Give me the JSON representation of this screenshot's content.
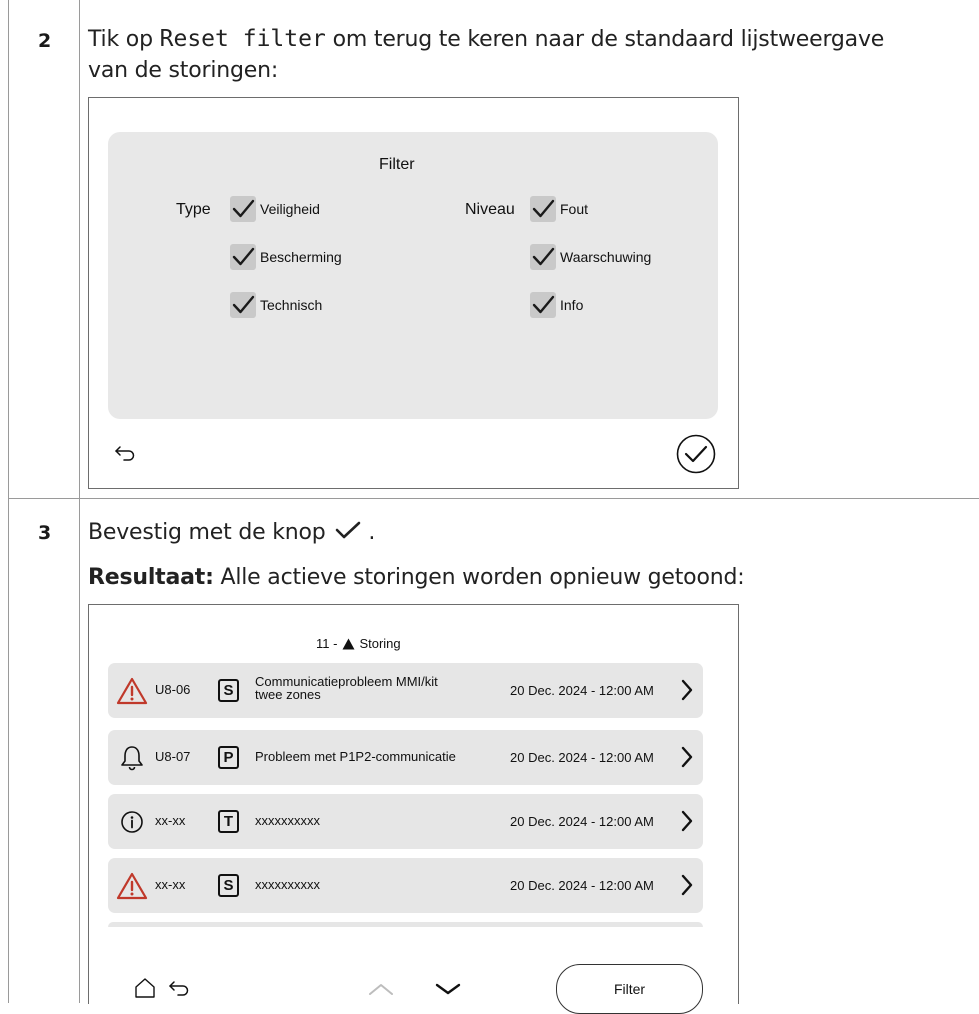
{
  "steps": [
    {
      "number": "2",
      "text_before": "Tik op ",
      "code": "Reset filter",
      "text_after": " om terug te keren naar de standaard lijstweergave",
      "text_line2": "van de storingen:"
    },
    {
      "number": "3",
      "text_before": "Bevestig met de knop ",
      "text_after": ".",
      "result_label": "Resultaat:",
      "result_text": " Alle actieve storingen worden opnieuw getoond:"
    }
  ],
  "filter_screen": {
    "title": "Filter",
    "type_group": {
      "label": "Type",
      "options": [
        {
          "label": "Veiligheid",
          "checked": true
        },
        {
          "label": "Bescherming",
          "checked": true
        },
        {
          "label": "Technisch",
          "checked": true
        }
      ]
    },
    "level_group": {
      "label": "Niveau",
      "options": [
        {
          "label": "Fout",
          "checked": true
        },
        {
          "label": "Waarschuwing",
          "checked": true
        },
        {
          "label": "Info",
          "checked": true
        }
      ]
    },
    "back_icon": "back-arrow-icon",
    "confirm_icon": "check-circle-icon"
  },
  "fault_screen": {
    "header_count": "11 -",
    "header_label": "Storing",
    "faults": [
      {
        "icon": "warning-triangle-icon",
        "code": "U8-06",
        "type": "S",
        "description_line1": "Communicatieprobleem MMI/kit",
        "description_line2": "twee zones",
        "date": "20 Dec. 2024 - 12:00 AM"
      },
      {
        "icon": "bell-icon",
        "code": "U8-07",
        "type": "P",
        "description_line1": "Probleem met P1P2-communicatie",
        "description_line2": "",
        "date": "20 Dec. 2024 - 12:00 AM"
      },
      {
        "icon": "info-circle-icon",
        "code": "xx-xx",
        "type": "T",
        "description_line1": "xxxxxxxxxx",
        "description_line2": "",
        "date": "20 Dec. 2024 - 12:00 AM"
      },
      {
        "icon": "warning-triangle-icon",
        "code": "xx-xx",
        "type": "S",
        "description_line1": "xxxxxxxxxx",
        "description_line2": "",
        "date": "20 Dec. 2024 - 12:00 AM"
      }
    ],
    "filter_button_label": "Filter"
  },
  "colors": {
    "warning": "#c0392b",
    "panel": "#e8e8e8",
    "row": "#e6e6e6",
    "checkbox": "#c9c9c9"
  }
}
